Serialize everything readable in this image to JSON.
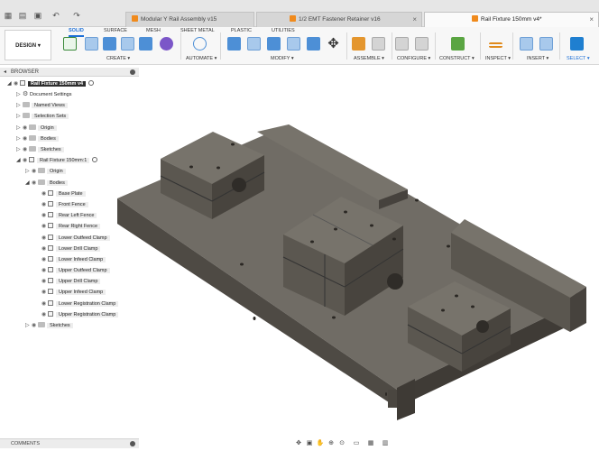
{
  "tabs": [
    {
      "label": "Modular Y Rail Assembly v15"
    },
    {
      "label": "1/2 EMT Fastener Retainer v16"
    },
    {
      "label": "Rail Fixture 150mm v4*"
    }
  ],
  "workspace": "DESIGN",
  "ribbon_tabs": [
    "SOLID",
    "SURFACE",
    "MESH",
    "SHEET METAL",
    "PLASTIC",
    "UTILITIES"
  ],
  "groups": [
    "CREATE",
    "AUTOMATE",
    "MODIFY",
    "ASSEMBLE",
    "CONFIGURE",
    "CONSTRUCT",
    "INSPECT",
    "INSERT",
    "SELECT"
  ],
  "browser": {
    "title": "BROWSER",
    "root": "Rail Fixture 150mm v4",
    "items": [
      "Document Settings",
      "Named Views",
      "Selection Sets",
      "Origin",
      "Bodies",
      "Sketches"
    ],
    "component": "Rail Fixture 150mm:1",
    "comp_items": [
      "Origin",
      "Bodies"
    ],
    "bodies": [
      "Base Plate",
      "Front Fence",
      "Rear Left Fence",
      "Rear Right Fence",
      "Lower Outfeed Clamp",
      "Lower Drill Clamp",
      "Lower Infeed Clamp",
      "Upper Outfeed Clamp",
      "Upper Drill Clamp",
      "Upper Infeed Clamp",
      "Lower Registration Clamp",
      "Upper Registration Clamp"
    ],
    "sketches2": "Sketches"
  },
  "comments": "COMMENTS",
  "colors": {
    "accent": "#1c6fd6",
    "model_top": "#6f6b64",
    "model_side": "#4f4b45",
    "model_dark": "#3c3934"
  }
}
